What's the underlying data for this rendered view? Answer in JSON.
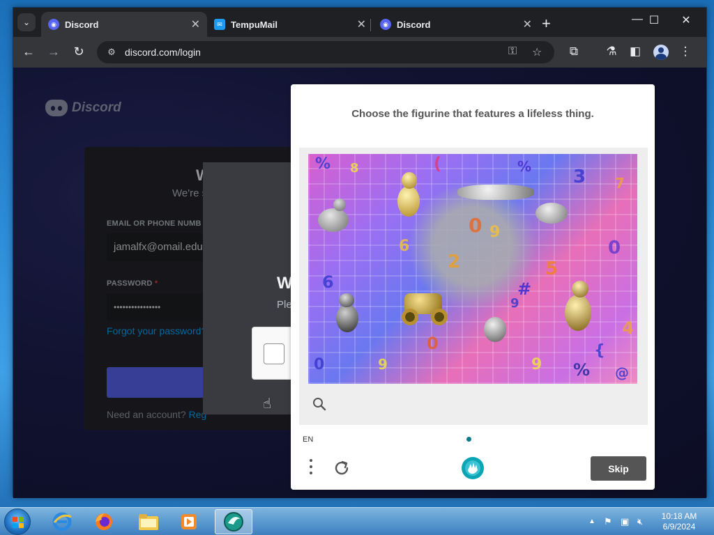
{
  "browser": {
    "tabs": [
      {
        "title": "Discord",
        "active": true
      },
      {
        "title": "TempuMail",
        "active": false
      },
      {
        "title": "Discord",
        "active": false
      }
    ],
    "url": "discord.com/login",
    "window_controls": {
      "minimize": "—",
      "maximize": "☐",
      "close": "✕"
    }
  },
  "discord_page": {
    "logo_text": "Discord",
    "login_heading": "W",
    "login_sub": "We're s",
    "email_label": "EMAIL OR PHONE NUMB",
    "email_value": "jamalfx@omail.edu",
    "password_label": "PASSWORD",
    "password_required": "*",
    "password_value": "••••••••••••••••",
    "forgot_link": "Forgot your password?",
    "need_account": "Need an account?",
    "register_link": "Reg",
    "modal_title": "W",
    "modal_sub": "Ple"
  },
  "captcha": {
    "prompt": "Choose the figurine that features a lifeless thing.",
    "language": "EN",
    "skip_label": "Skip"
  },
  "taskbar": {
    "time": "10:18 AM",
    "date": "6/9/2024"
  },
  "colors": {
    "discord_blurple": "#5865f2",
    "skip_button": "#555555",
    "captcha_dot": "#0b7a8a"
  }
}
